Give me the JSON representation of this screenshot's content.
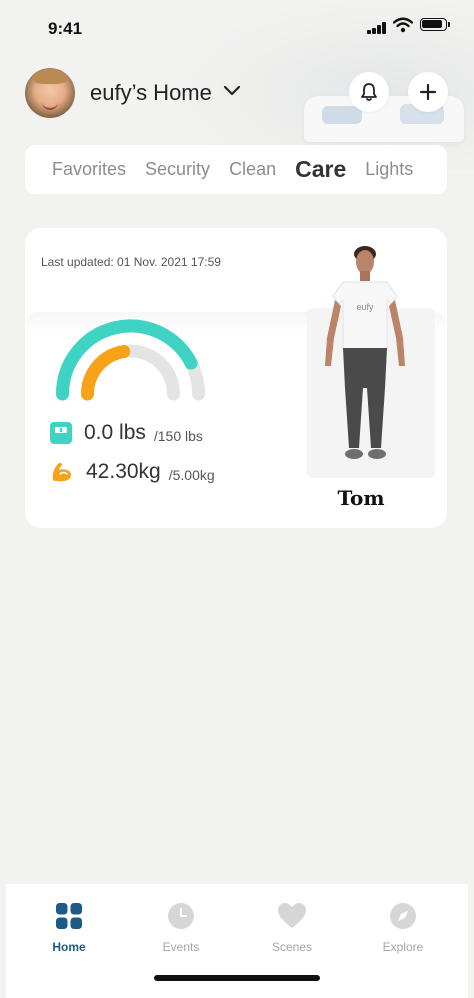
{
  "status_bar": {
    "time": "9:41",
    "icons": [
      "signal-icon",
      "wifi-icon",
      "battery-icon"
    ]
  },
  "header": {
    "home_name": "eufy’s Home",
    "icons": [
      "avatar",
      "chevron-down-icon",
      "bell-icon",
      "plus-icon"
    ]
  },
  "tabs": [
    {
      "label": "Favorites",
      "active": false
    },
    {
      "label": "Security",
      "active": false
    },
    {
      "label": "Clean",
      "active": false
    },
    {
      "label": "Care",
      "active": true
    },
    {
      "label": "Lights",
      "active": false
    }
  ],
  "care_card": {
    "last_updated": "Last updated: 01 Nov. 2021 17:59",
    "gauge": {
      "outer_progress": 0.85,
      "inner_progress": 0.45,
      "outer_color": "#3ed3c2",
      "inner_color": "#f6a31a",
      "track_color": "#e4e4e4"
    },
    "weight": {
      "value": "0.0 lbs",
      "goal": "/150 lbs",
      "icon": "scale-icon",
      "color": "#3ed3c2"
    },
    "muscle": {
      "value": "42.30kg",
      "goal": "/5.00kg",
      "icon": "muscle-icon",
      "color": "#f6a31a"
    },
    "person": {
      "name": "Tom",
      "shirt_text": "eufy"
    }
  },
  "bottom_nav": [
    {
      "label": "Home",
      "icon": "grid-icon",
      "active": true
    },
    {
      "label": "Events",
      "icon": "clock-icon",
      "active": false
    },
    {
      "label": "Scenes",
      "icon": "heart-icon",
      "active": false
    },
    {
      "label": "Explore",
      "icon": "compass-icon",
      "active": false
    }
  ],
  "colors": {
    "background": "#f2f2f1",
    "nav_active": "#1e5a86",
    "nav_inactive": "#a5a5a5"
  }
}
